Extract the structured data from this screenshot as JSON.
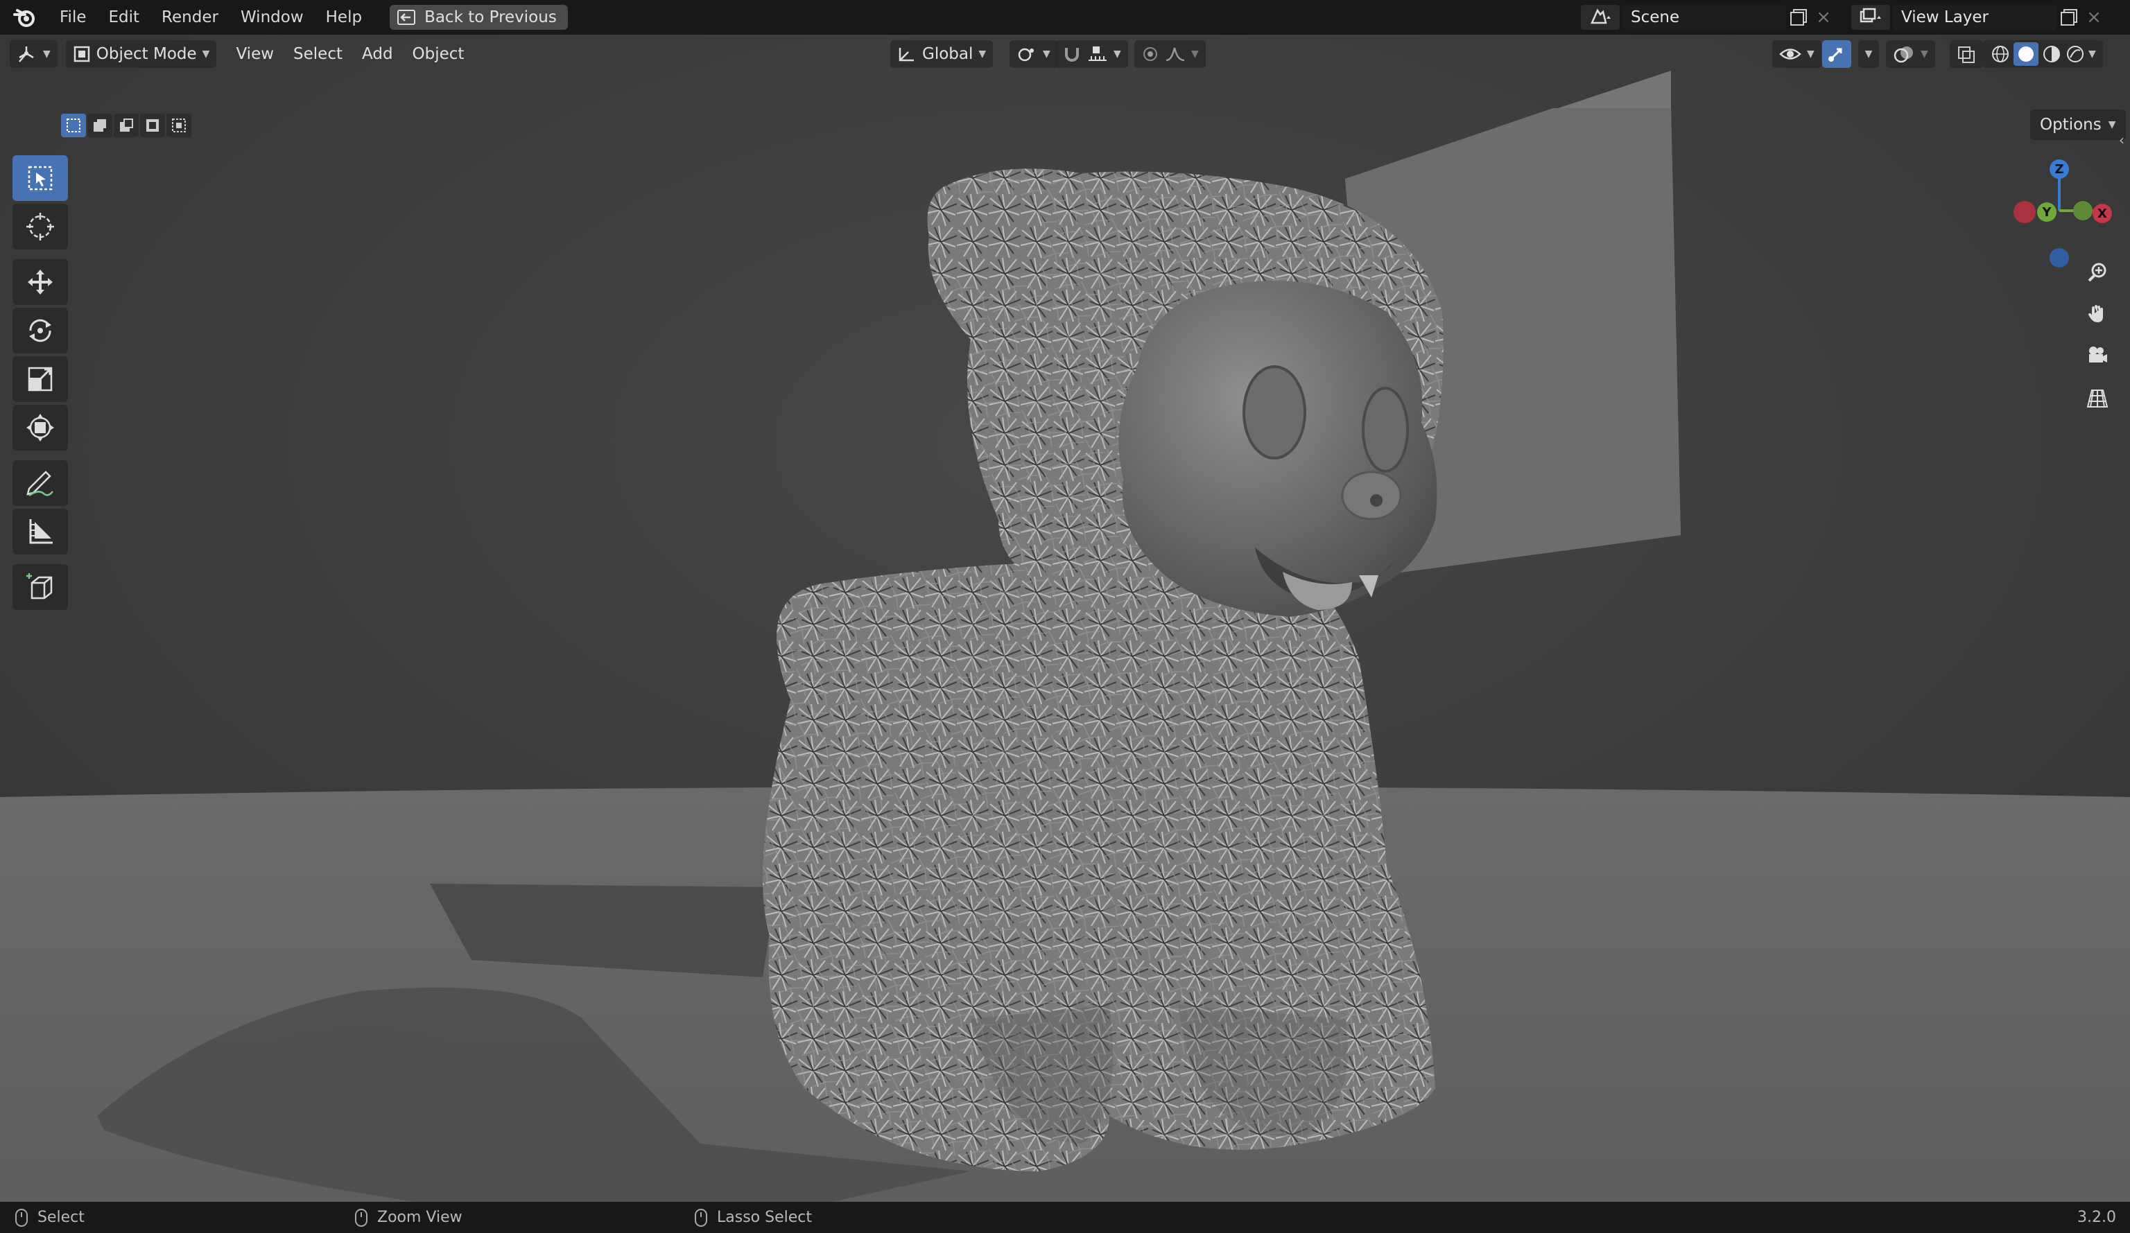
{
  "topbar": {
    "menus": [
      "File",
      "Edit",
      "Render",
      "Window",
      "Help"
    ],
    "back_button": "Back to Previous",
    "scene_name": "Scene",
    "view_layer_name": "View Layer"
  },
  "header": {
    "mode": "Object Mode",
    "menus": [
      "View",
      "Select",
      "Add",
      "Object"
    ],
    "transform_orientation": "Global",
    "options_label": "Options"
  },
  "toolbar": {
    "tools": [
      "select-box",
      "cursor",
      "move",
      "rotate",
      "scale",
      "transform",
      "annotate",
      "measure",
      "add-cube"
    ]
  },
  "gizmo": {
    "z": "Z",
    "y": "Y",
    "x": "X"
  },
  "status": {
    "select": "Select",
    "zoom": "Zoom View",
    "lasso": "Lasso Select",
    "version": "3.2.0"
  },
  "colors": {
    "accent": "#4772b3",
    "axis_x": "#c3394a",
    "axis_y": "#70a93a",
    "axis_z": "#3b7bd1"
  }
}
